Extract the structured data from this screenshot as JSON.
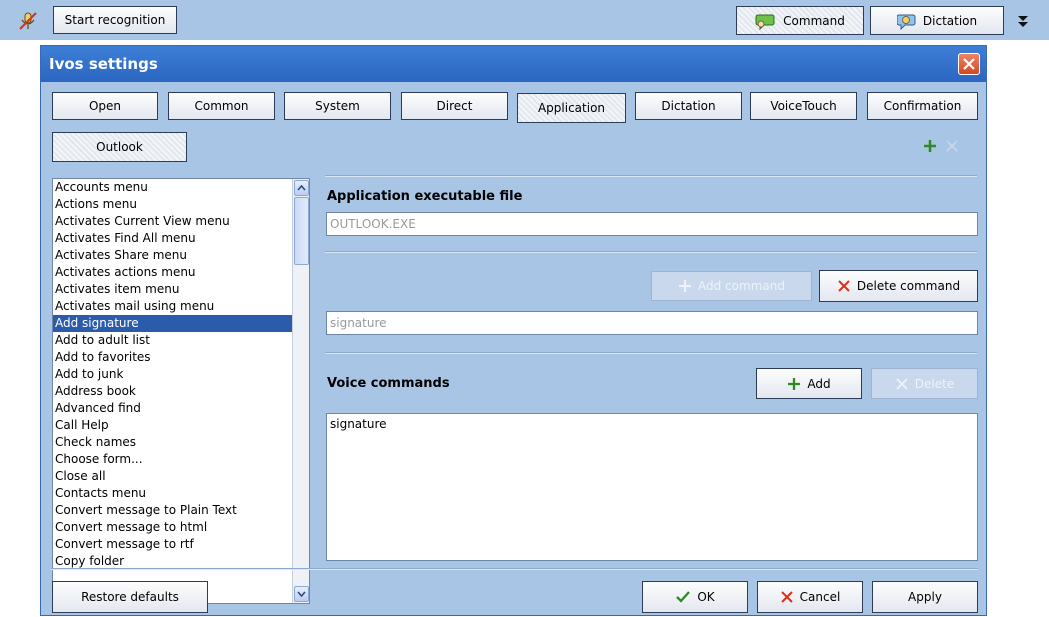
{
  "toolbar": {
    "start_label": "Start recognition",
    "command_label": "Command",
    "dictation_label": "Dictation"
  },
  "dialog": {
    "title": "Ivos settings",
    "tabs": [
      "Open",
      "Common",
      "System",
      "Direct",
      "Application",
      "Dictation",
      "VoiceTouch",
      "Confirmation"
    ],
    "active_tab": "Application",
    "subtab": "Outlook"
  },
  "commands": [
    "Accounts menu",
    "Actions menu",
    "Activates Current View menu",
    "Activates Find All menu",
    "Activates Share menu",
    "Activates actions menu",
    "Activates item menu",
    "Activates mail using menu",
    "Add signature",
    "Add to adult list",
    "Add to favorites",
    "Add to junk",
    "Address book",
    "Advanced find",
    "Call Help",
    "Check names",
    "Choose form...",
    "Close all",
    "Contacts menu",
    "Convert message to Plain Text",
    "Convert message to html",
    "Convert message to rtf",
    "Copy folder"
  ],
  "selected_command": "Add signature",
  "app": {
    "exe_label": "Application executable file",
    "exe_value": "OUTLOOK.EXE",
    "add_command": "Add command",
    "delete_command": "Delete command",
    "command_value": "signature",
    "voice_label": "Voice commands",
    "add": "Add",
    "delete": "Delete",
    "voice_value": "signature"
  },
  "footer": {
    "restore": "Restore defaults",
    "ok": "OK",
    "cancel": "Cancel",
    "apply": "Apply"
  },
  "colors": {
    "panel": "#a8c5e6",
    "title_bar": "#2f6fcb",
    "selection": "#2d5bac",
    "plus": "#2f8a1f",
    "cross": "#d9321b"
  }
}
